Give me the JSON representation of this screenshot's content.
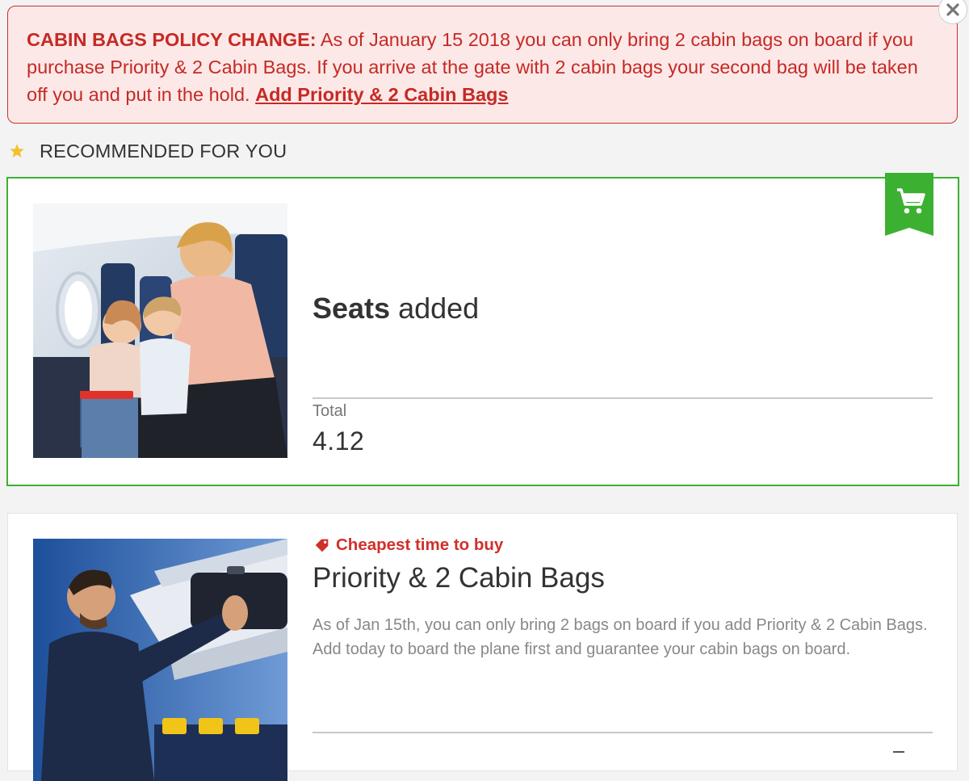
{
  "banner": {
    "lead": "CABIN BAGS POLICY CHANGE:",
    "message": " As of January 15 2018 you can only bring 2 cabin bags on board if you purchase Priority & 2 Cabin Bags. If you arrive at the gate with 2 cabin bags your second bag will be taken off you and put in the hold. ",
    "link_label": "Add Priority & 2 Cabin Bags",
    "close_icon": "close-icon"
  },
  "recommended": {
    "icon": "star-icon",
    "heading": "RECOMMENDED FOR YOU"
  },
  "seats_card": {
    "image": "family-in-plane-seats-photo",
    "cart_icon": "shopping-cart-icon",
    "title_bold": "Seats",
    "title_rest": " added",
    "total_label": "Total",
    "total_value": "4.12",
    "accent_color": "#3cb031"
  },
  "bags_card": {
    "image": "man-loading-overhead-bin-photo",
    "tag_icon": "price-tag-icon",
    "tag_label": "Cheapest time to buy",
    "title": "Priority & 2 Cabin Bags",
    "description": "As of Jan 15th, you can only bring 2 bags on board if you add Priority & 2 Cabin Bags. Add today to board the plane first and guarantee your cabin bags on board."
  },
  "colors": {
    "alert_red": "#c52a24",
    "alert_bg": "#fde8e8",
    "star_gold": "#f2c12e",
    "success_green": "#3cb031"
  }
}
